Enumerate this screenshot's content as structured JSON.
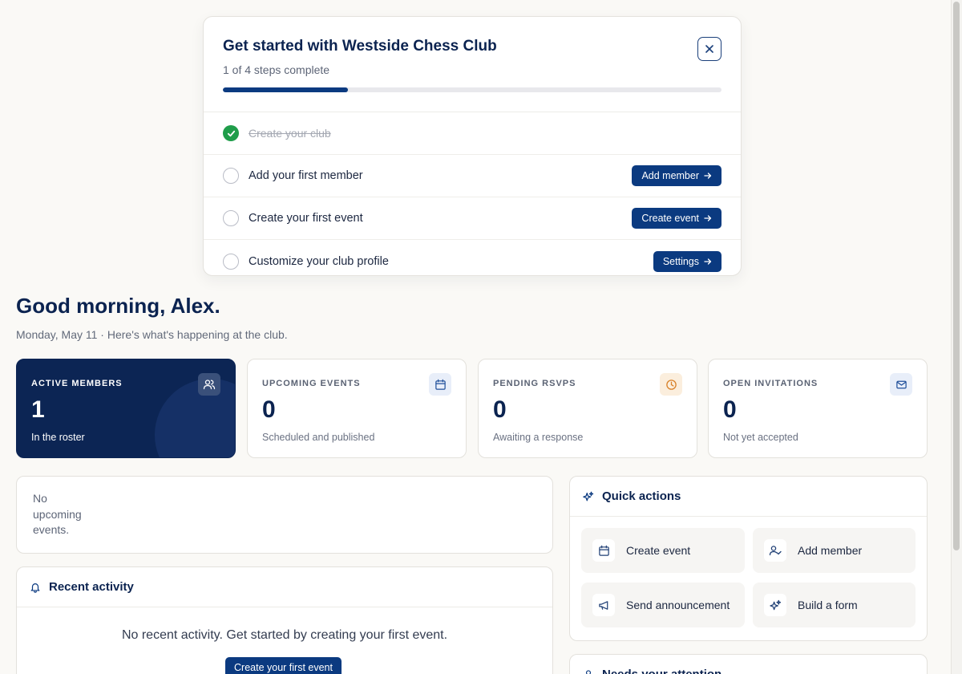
{
  "onboarding": {
    "title": "Get started with Westside Chess Club",
    "progress_text": "1 of 4 steps complete",
    "progress_fraction": 0.25,
    "steps": [
      {
        "label": "Create your club",
        "done": true
      },
      {
        "label": "Add your first member",
        "done": false,
        "button": "Add member"
      },
      {
        "label": "Create your first event",
        "done": false,
        "button": "Create event"
      },
      {
        "label": "Customize your club profile",
        "done": false,
        "button": "Settings"
      }
    ]
  },
  "greeting": {
    "title": "Good morning, Alex.",
    "subtitle": "Monday, May 11 · Here's what's happening at the club."
  },
  "stats": [
    {
      "label": "ACTIVE MEMBERS",
      "value": "1",
      "sub": "In the roster",
      "icon": "users-icon"
    },
    {
      "label": "UPCOMING EVENTS",
      "value": "0",
      "sub": "Scheduled and published",
      "icon": "calendar-icon"
    },
    {
      "label": "PENDING RSVPS",
      "value": "0",
      "sub": "Awaiting a response",
      "icon": "clock-icon"
    },
    {
      "label": "OPEN INVITATIONS",
      "value": "0",
      "sub": "Not yet accepted",
      "icon": "mail-icon"
    }
  ],
  "events_panel": {
    "empty_text": "No upcoming events."
  },
  "quick_actions": {
    "title": "Quick actions",
    "items": [
      {
        "label": "Create event",
        "icon": "calendar-icon"
      },
      {
        "label": "Add member",
        "icon": "user-check-icon"
      },
      {
        "label": "Send announcement",
        "icon": "megaphone-icon"
      },
      {
        "label": "Build a form",
        "icon": "sparkles-icon"
      }
    ]
  },
  "recent_activity": {
    "title": "Recent activity",
    "empty_text": "No recent activity. Get started by creating your first event.",
    "button": "Create your first event"
  },
  "attention": {
    "title": "Needs your attention"
  },
  "colors": {
    "primary": "#0b3a80",
    "dark_card": "#0c2554",
    "success": "#1f9d4a",
    "background": "#faf9f6"
  }
}
